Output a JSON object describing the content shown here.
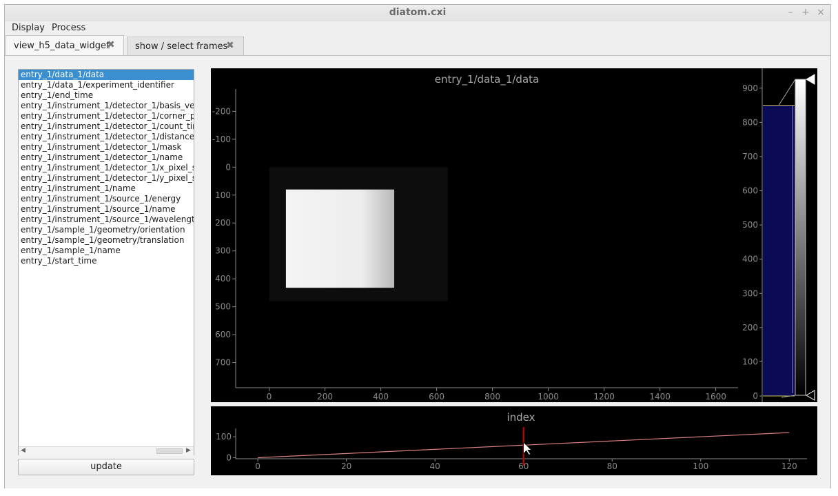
{
  "window": {
    "title": "diatom.cxi",
    "minimize": "–",
    "maximize": "+",
    "close": "×"
  },
  "menubar": {
    "items": [
      "Display",
      "Process"
    ]
  },
  "tabs": [
    {
      "label": "view_h5_data_widget",
      "close": "✖"
    },
    {
      "label": "show / select frames",
      "close": "✖"
    }
  ],
  "dataset_list": {
    "selected_index": 0,
    "items": [
      "entry_1/data_1/data",
      "entry_1/data_1/experiment_identifier",
      "entry_1/end_time",
      "entry_1/instrument_1/detector_1/basis_ve",
      "entry_1/instrument_1/detector_1/corner_p",
      "entry_1/instrument_1/detector_1/count_tir",
      "entry_1/instrument_1/detector_1/distance",
      "entry_1/instrument_1/detector_1/mask",
      "entry_1/instrument_1/detector_1/name",
      "entry_1/instrument_1/detector_1/x_pixel_s",
      "entry_1/instrument_1/detector_1/y_pixel_s",
      "entry_1/instrument_1/name",
      "entry_1/instrument_1/source_1/energy",
      "entry_1/instrument_1/source_1/name",
      "entry_1/instrument_1/source_1/wavelengt",
      "entry_1/sample_1/geometry/orientation",
      "entry_1/sample_1/geometry/translation",
      "entry_1/sample_1/name",
      "entry_1/start_time"
    ],
    "scroll_left_icon": "triangle-left",
    "scroll_right_icon": "triangle-right"
  },
  "update_button": "update",
  "colors": {
    "plot_bg": "#000000",
    "axis": "#8a8a8a",
    "hist_fill": "#0a0a55",
    "index_line": "#d98080",
    "cursor_line": "#cc0000",
    "selection": "#3a8fd1"
  },
  "chart_data": [
    {
      "type": "heatmap",
      "title": "entry_1/data_1/data",
      "x_ticks": [
        0,
        200,
        400,
        600,
        800,
        1000,
        1200,
        1400,
        1600
      ],
      "y_ticks": [
        -200,
        -100,
        0,
        100,
        200,
        300,
        400,
        500,
        600,
        700
      ],
      "xlim": [
        -120,
        1680
      ],
      "ylim": [
        -280,
        790
      ],
      "y_inverted": true,
      "detector_frame": {
        "x": [
          0,
          640
        ],
        "y": [
          0,
          480
        ]
      },
      "bright_region": {
        "x": [
          60,
          448
        ],
        "y": [
          80,
          432
        ]
      }
    },
    {
      "type": "area",
      "name": "histogram",
      "y_ticks": [
        0,
        100,
        200,
        300,
        400,
        500,
        600,
        700,
        800,
        900
      ],
      "ylim": [
        -10,
        940
      ],
      "level_max": 850,
      "level_min": 0
    },
    {
      "type": "line",
      "title": "index",
      "x_ticks": [
        0,
        20,
        40,
        60,
        80,
        100,
        120
      ],
      "y_ticks": [
        0,
        100
      ],
      "xlim": [
        -5,
        124
      ],
      "ylim": [
        -5,
        140
      ],
      "x": [
        0,
        120
      ],
      "y": [
        0,
        120
      ],
      "cursor_x": 60
    }
  ]
}
